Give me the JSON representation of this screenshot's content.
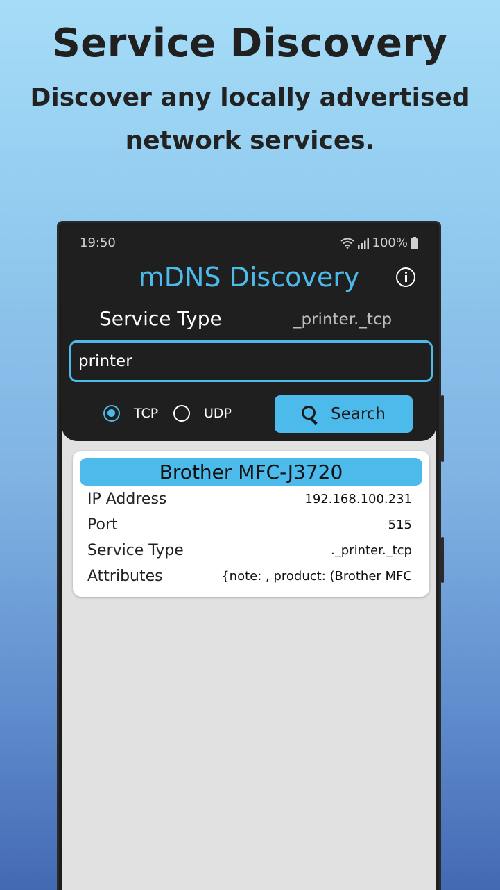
{
  "hero": {
    "title": "Service Discovery",
    "subtitle": "Discover any locally advertised network services."
  },
  "status_bar": {
    "time": "19:50",
    "battery": "100%",
    "icons": [
      "wifi-icon",
      "signal-icon",
      "battery-icon"
    ]
  },
  "app": {
    "title": "mDNS Discovery",
    "info_icon": "info-icon"
  },
  "service_type": {
    "label": "Service Type",
    "value": "_printer._tcp"
  },
  "search": {
    "input_value": "printer",
    "button_label": "Search",
    "icon": "search-icon"
  },
  "protocol": {
    "options": [
      "TCP",
      "UDP"
    ],
    "selected": "TCP"
  },
  "result": {
    "name": "Brother MFC-J3720",
    "rows": [
      {
        "label": "IP Address",
        "value": "192.168.100.231"
      },
      {
        "label": "Port",
        "value": "515"
      },
      {
        "label": "Service Type",
        "value": "._printer._tcp"
      },
      {
        "label": "Attributes",
        "value": "{note: , product: (Brother MFC"
      }
    ]
  },
  "colors": {
    "accent": "#4cbbec",
    "header_bg": "#1f1f1f",
    "list_bg": "#e1e1e1"
  }
}
